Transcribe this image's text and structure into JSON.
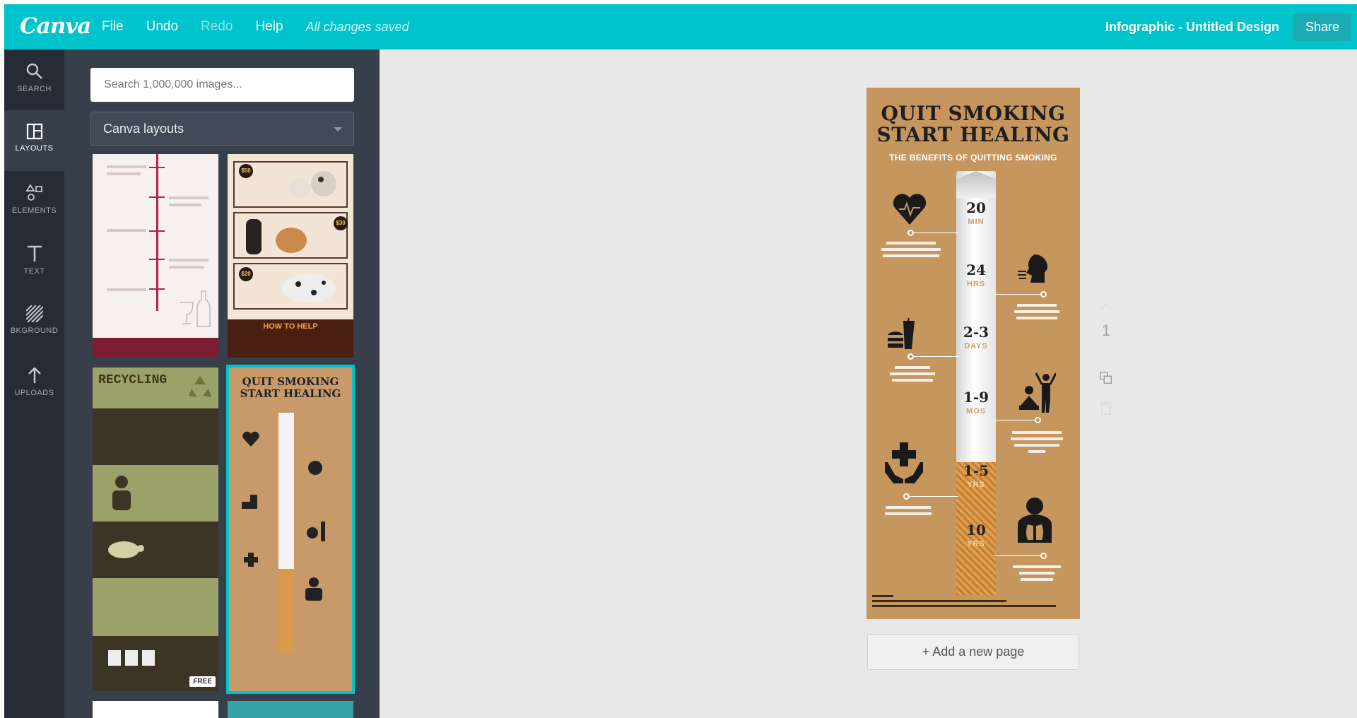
{
  "topbar": {
    "logo": "Canva",
    "menu": {
      "file": "File",
      "undo": "Undo",
      "redo": "Redo",
      "help": "Help",
      "status": "All changes saved"
    },
    "doc_title": "Infographic - Untitled Design",
    "share": "Share",
    "accent": "#00c4cc"
  },
  "rail": {
    "search": "SEARCH",
    "layouts": "LAYOUTS",
    "elements": "ELEMENTS",
    "text": "TEXT",
    "background": "BKGROUND",
    "uploads": "UPLOADS"
  },
  "panel": {
    "search_placeholder": "Search 1,000,000 images...",
    "select_value": "Canva layouts",
    "thumbs": {
      "t2_howto": "HOW TO HELP",
      "t3_title": "RECYCLING",
      "t4_title_line1": "QUIT SMOKING",
      "t4_title_line2": "START HEALING",
      "free_badge": "FREE"
    }
  },
  "canvas": {
    "title_line1": "QUIT SMOKING",
    "title_line2": "START HEALING",
    "subtitle": "THE BENEFITS OF QUITTING SMOKING",
    "milestones": [
      {
        "num": "20",
        "unit": "MIN"
      },
      {
        "num": "24",
        "unit": "HRS"
      },
      {
        "num": "2-3",
        "unit": "DAYS"
      },
      {
        "num": "1-9",
        "unit": "MOS"
      },
      {
        "num": "1-5",
        "unit": "YRS"
      },
      {
        "num": "10",
        "unit": "YRS"
      }
    ],
    "add_page": "+ Add a new page",
    "page_number": "1"
  }
}
